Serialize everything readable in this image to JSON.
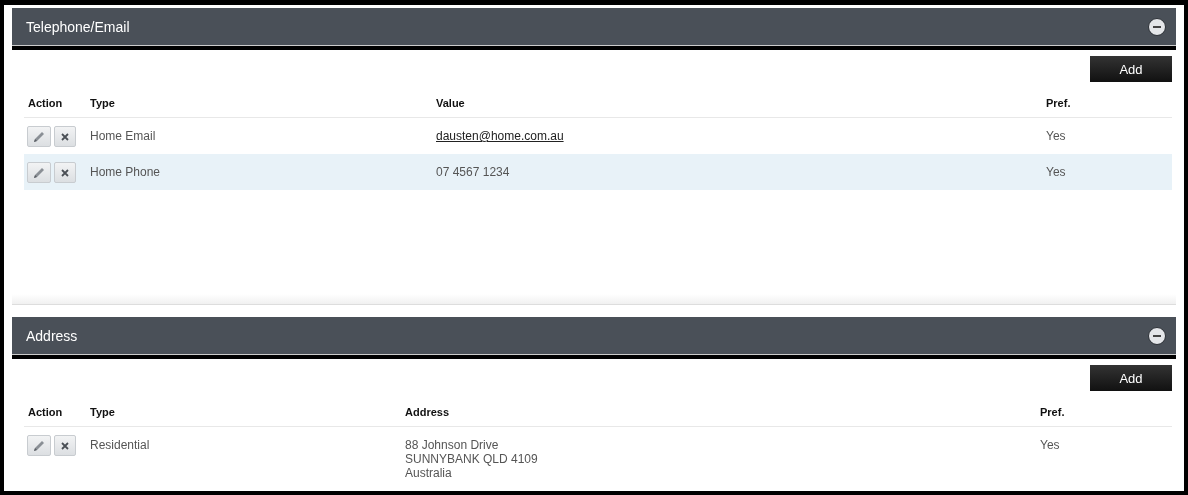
{
  "sections": [
    {
      "title": "Telephone/Email",
      "expanded": true,
      "add_button": "Add",
      "columns": [
        "Action",
        "Type",
        "Value",
        "Pref."
      ],
      "rows": [
        {
          "type": "Home Email",
          "value": {
            "kind": "link",
            "lines": [
              "dausten@home.com.au"
            ]
          },
          "pref": "Yes",
          "highlighted": false
        },
        {
          "type": "Home Phone",
          "value": {
            "kind": "text",
            "lines": [
              "07 4567 1234"
            ]
          },
          "pref": "Yes",
          "highlighted": true
        }
      ]
    },
    {
      "title": "Address",
      "expanded": true,
      "add_button": "Add",
      "columns": [
        "Action",
        "Type",
        "Address",
        "Pref."
      ],
      "rows": [
        {
          "type": "Residential",
          "value": {
            "kind": "text",
            "lines": [
              "88 Johnson Drive",
              "SUNNYBANK QLD 4109",
              "Australia"
            ]
          },
          "pref": "Yes",
          "highlighted": false
        }
      ]
    }
  ]
}
